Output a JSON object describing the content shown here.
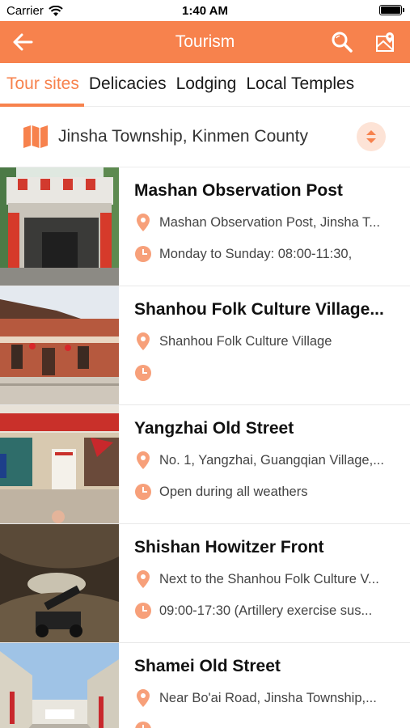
{
  "status_bar": {
    "carrier": "Carrier",
    "time": "1:40 AM"
  },
  "nav": {
    "title": "Tourism"
  },
  "tabs": [
    {
      "label": "Tour sites",
      "active": true
    },
    {
      "label": "Delicacies",
      "active": false
    },
    {
      "label": "Lodging",
      "active": false
    },
    {
      "label": "Local Temples",
      "active": false
    }
  ],
  "location": {
    "text": "Jinsha Township, Kinmen County"
  },
  "colors": {
    "accent": "#f7824d",
    "accent_light": "#fde3d6"
  },
  "icons": {
    "back": "arrow-left-icon",
    "search": "search-icon",
    "map": "map-pin-icon",
    "folded_map": "folded-map-icon",
    "sort": "sort-arrows-icon",
    "pin": "location-pin-icon",
    "clock": "clock-icon"
  },
  "places": [
    {
      "name": "Mashan Observation Post",
      "address": "Mashan Observation Post, Jinsha T...",
      "hours": "Monday to Sunday: 08:00-11:30,"
    },
    {
      "name": "Shanhou Folk Culture Village...",
      "address": "Shanhou Folk Culture Village",
      "hours": ""
    },
    {
      "name": "Yangzhai Old Street",
      "address": "No. 1, Yangzhai, Guangqian Village,...",
      "hours": "Open during all weathers"
    },
    {
      "name": "Shishan Howitzer Front",
      "address": "Next to the Shanhou Folk Culture V...",
      "hours": "09:00-17:30 (Artillery exercise sus..."
    },
    {
      "name": "Shamei Old Street",
      "address": "Near Bo'ai Road, Jinsha Township,...",
      "hours": ""
    }
  ]
}
